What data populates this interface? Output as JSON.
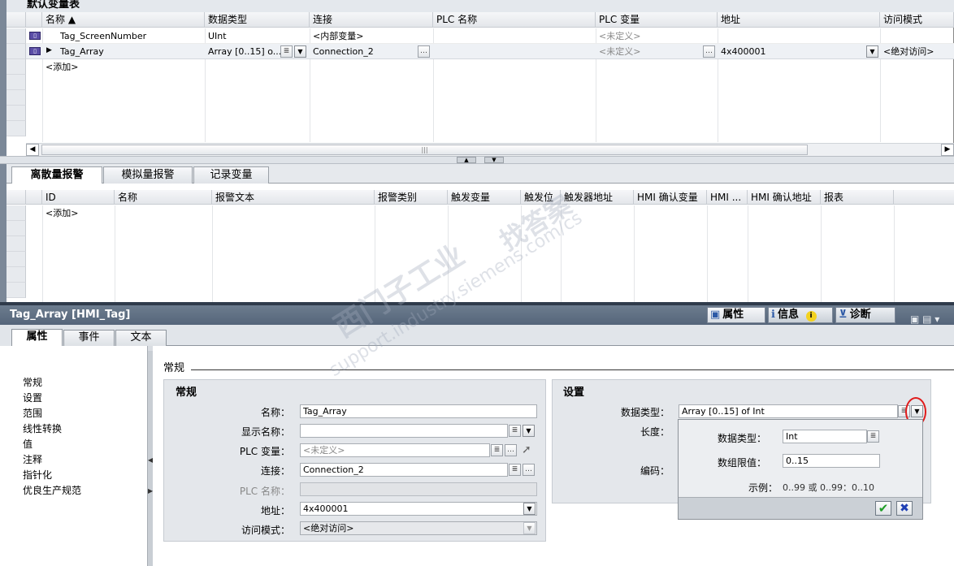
{
  "top_table": {
    "title": "默认变量表",
    "columns": [
      "名称 ▲",
      "数据类型",
      "连接",
      "PLC 名称",
      "PLC 变量",
      "地址",
      "访问模式"
    ],
    "rows": [
      {
        "name": "Tag_ScreenNumber",
        "datatype": "UInt",
        "connection": "<内部变量>",
        "plc_name": "",
        "plc_var": "<未定义>",
        "address": "",
        "access": ""
      },
      {
        "name": "Tag_Array",
        "datatype": "Array [0..15] o...",
        "connection": "Connection_2",
        "plc_name": "",
        "plc_var": "<未定义>",
        "address": "4x400001",
        "access": "<绝对访问>"
      }
    ],
    "add_label": "<添加>"
  },
  "alarm_tabs": [
    "离散量报警",
    "模拟量报警",
    "记录变量"
  ],
  "alarm_table": {
    "columns": [
      "ID",
      "名称",
      "报警文本",
      "报警类别",
      "触发变量",
      "触发位",
      "触发器地址",
      "HMI 确认变量",
      "HMI ...",
      "HMI 确认地址",
      "报表"
    ],
    "add_label": "<添加>"
  },
  "inspector": {
    "title": "Tag_Array [HMI_Tag]",
    "top_tabs": [
      "属性",
      "信息",
      "诊断"
    ],
    "tabs": [
      "属性",
      "事件",
      "文本"
    ],
    "nav": [
      "常规",
      "设置",
      "范围",
      "线性转换",
      "值",
      "注释",
      "指针化",
      "优良生产规范"
    ],
    "section_title": "常规"
  },
  "general_group": {
    "title": "常规",
    "name_label": "名称：",
    "name_value": "Tag_Array",
    "display_name_label": "显示名称：",
    "display_name_value": "",
    "plc_var_label": "PLC 变量：",
    "plc_var_value": "<未定义>",
    "connection_label": "连接：",
    "connection_value": "Connection_2",
    "plc_name_label": "PLC 名称：",
    "plc_name_value": "",
    "address_label": "地址：",
    "address_value": "4x400001",
    "access_label": "访问模式：",
    "access_value": "<绝对访问>"
  },
  "settings_group": {
    "title": "设置",
    "datatype_label": "数据类型：",
    "datatype_value": "Array [0..15] of Int",
    "length_label": "长度：",
    "encoding_label": "编码："
  },
  "popup": {
    "datatype_label": "数据类型：",
    "datatype_value": "Int",
    "array_limit_label": "数组限值：",
    "array_limit_value": "0..15",
    "example_label": "示例：",
    "example_value": "0..99 或 0..99：0..10"
  },
  "watermark": [
    "西门子工业",
    "support.industry.siemens.com/cs",
    "找答案"
  ]
}
